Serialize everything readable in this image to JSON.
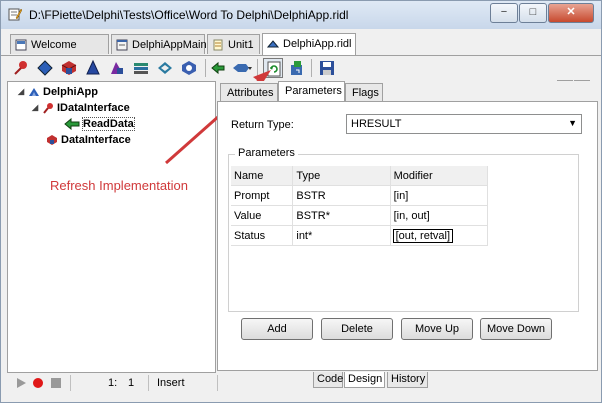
{
  "window": {
    "title": "D:\\FPiette\\Delphi\\Tests\\Office\\Word To Delphi\\DelphiApp.ridl"
  },
  "window_buttons": {
    "minimize": "−",
    "maximize": "□",
    "close": "✕"
  },
  "file_tabs": [
    {
      "label": "Welcome Page",
      "icon": "welcome-page-icon"
    },
    {
      "label": "DelphiAppMain",
      "icon": "form-icon"
    },
    {
      "label": "Unit1",
      "icon": "unit-icon"
    },
    {
      "label": "DelphiApp.ridl",
      "icon": "ridl-icon"
    }
  ],
  "tab_controls": {
    "dropdown": "▾",
    "close": "×"
  },
  "toolbar": {
    "buttons": [
      "new-interface-icon",
      "new-dispinterface-icon",
      "new-coclass-icon",
      "new-enum-icon",
      "new-alias-icon",
      "new-record-icon",
      "new-union-icon",
      "new-module-icon",
      "new-method-icon",
      "new-property-icon",
      "refresh-implementation-icon",
      "register-type-library-icon",
      "save-icon"
    ]
  },
  "tree": {
    "root": {
      "label": "DelphiApp",
      "icon": "type-library-icon"
    },
    "items": [
      {
        "label": "IDataInterface",
        "icon": "interface-icon"
      },
      {
        "label": "ReadData",
        "icon": "method-icon"
      },
      {
        "label": "DataInterface",
        "icon": "coclass-icon"
      }
    ]
  },
  "callout": {
    "text": "Refresh Implementation",
    "color": "#d0393a"
  },
  "page_tabs": [
    "Attributes",
    "Parameters",
    "Flags"
  ],
  "return_type": {
    "label": "Return Type:",
    "value": "HRESULT"
  },
  "parameters": {
    "group_label": "Parameters",
    "columns": [
      "Name",
      "Type",
      "Modifier"
    ],
    "rows": [
      {
        "name": "Prompt",
        "type": "BSTR",
        "modifier": "[in]"
      },
      {
        "name": "Value",
        "type": "BSTR*",
        "modifier": "[in, out]"
      },
      {
        "name": "Status",
        "type": "int*",
        "modifier": "[out, retval]"
      }
    ]
  },
  "buttons": {
    "add": "Add",
    "delete": "Delete",
    "move_up": "Move Up",
    "move_down": "Move Down"
  },
  "bottom_tabs": [
    "Code",
    "Design",
    "History"
  ],
  "status": {
    "line": "1:",
    "col": "1",
    "mode": "Insert"
  }
}
